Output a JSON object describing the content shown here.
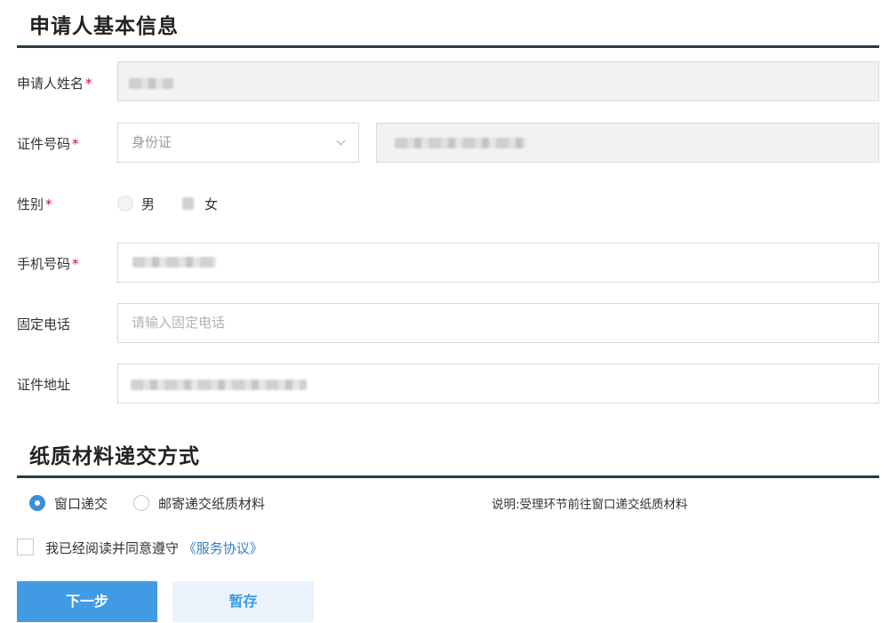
{
  "applicant_section": {
    "title": "申请人基本信息",
    "name": {
      "label": "申请人姓名",
      "required": "*"
    },
    "id_number": {
      "label": "证件号码",
      "required": "*",
      "id_type_selected": "身份证"
    },
    "gender": {
      "label": "性别",
      "required": "*",
      "options": [
        "男",
        "女"
      ]
    },
    "mobile": {
      "label": "手机号码",
      "required": "*"
    },
    "landline": {
      "label": "固定电话",
      "placeholder": "请输入固定电话"
    },
    "address": {
      "label": "证件地址"
    }
  },
  "delivery_section": {
    "title": "纸质材料递交方式",
    "options": [
      "窗口递交",
      "邮寄递交纸质材料"
    ],
    "selected": "窗口递交",
    "note": "说明:受理环节前往窗口递交纸质材料"
  },
  "agreement": {
    "text": "我已经阅读并同意遵守",
    "link": "《服务协议》"
  },
  "buttons": {
    "next": "下一步",
    "save_draft": "暂存"
  },
  "colors": {
    "accent": "#409be4",
    "required": "#c8102e",
    "rule": "#2b3a44"
  }
}
